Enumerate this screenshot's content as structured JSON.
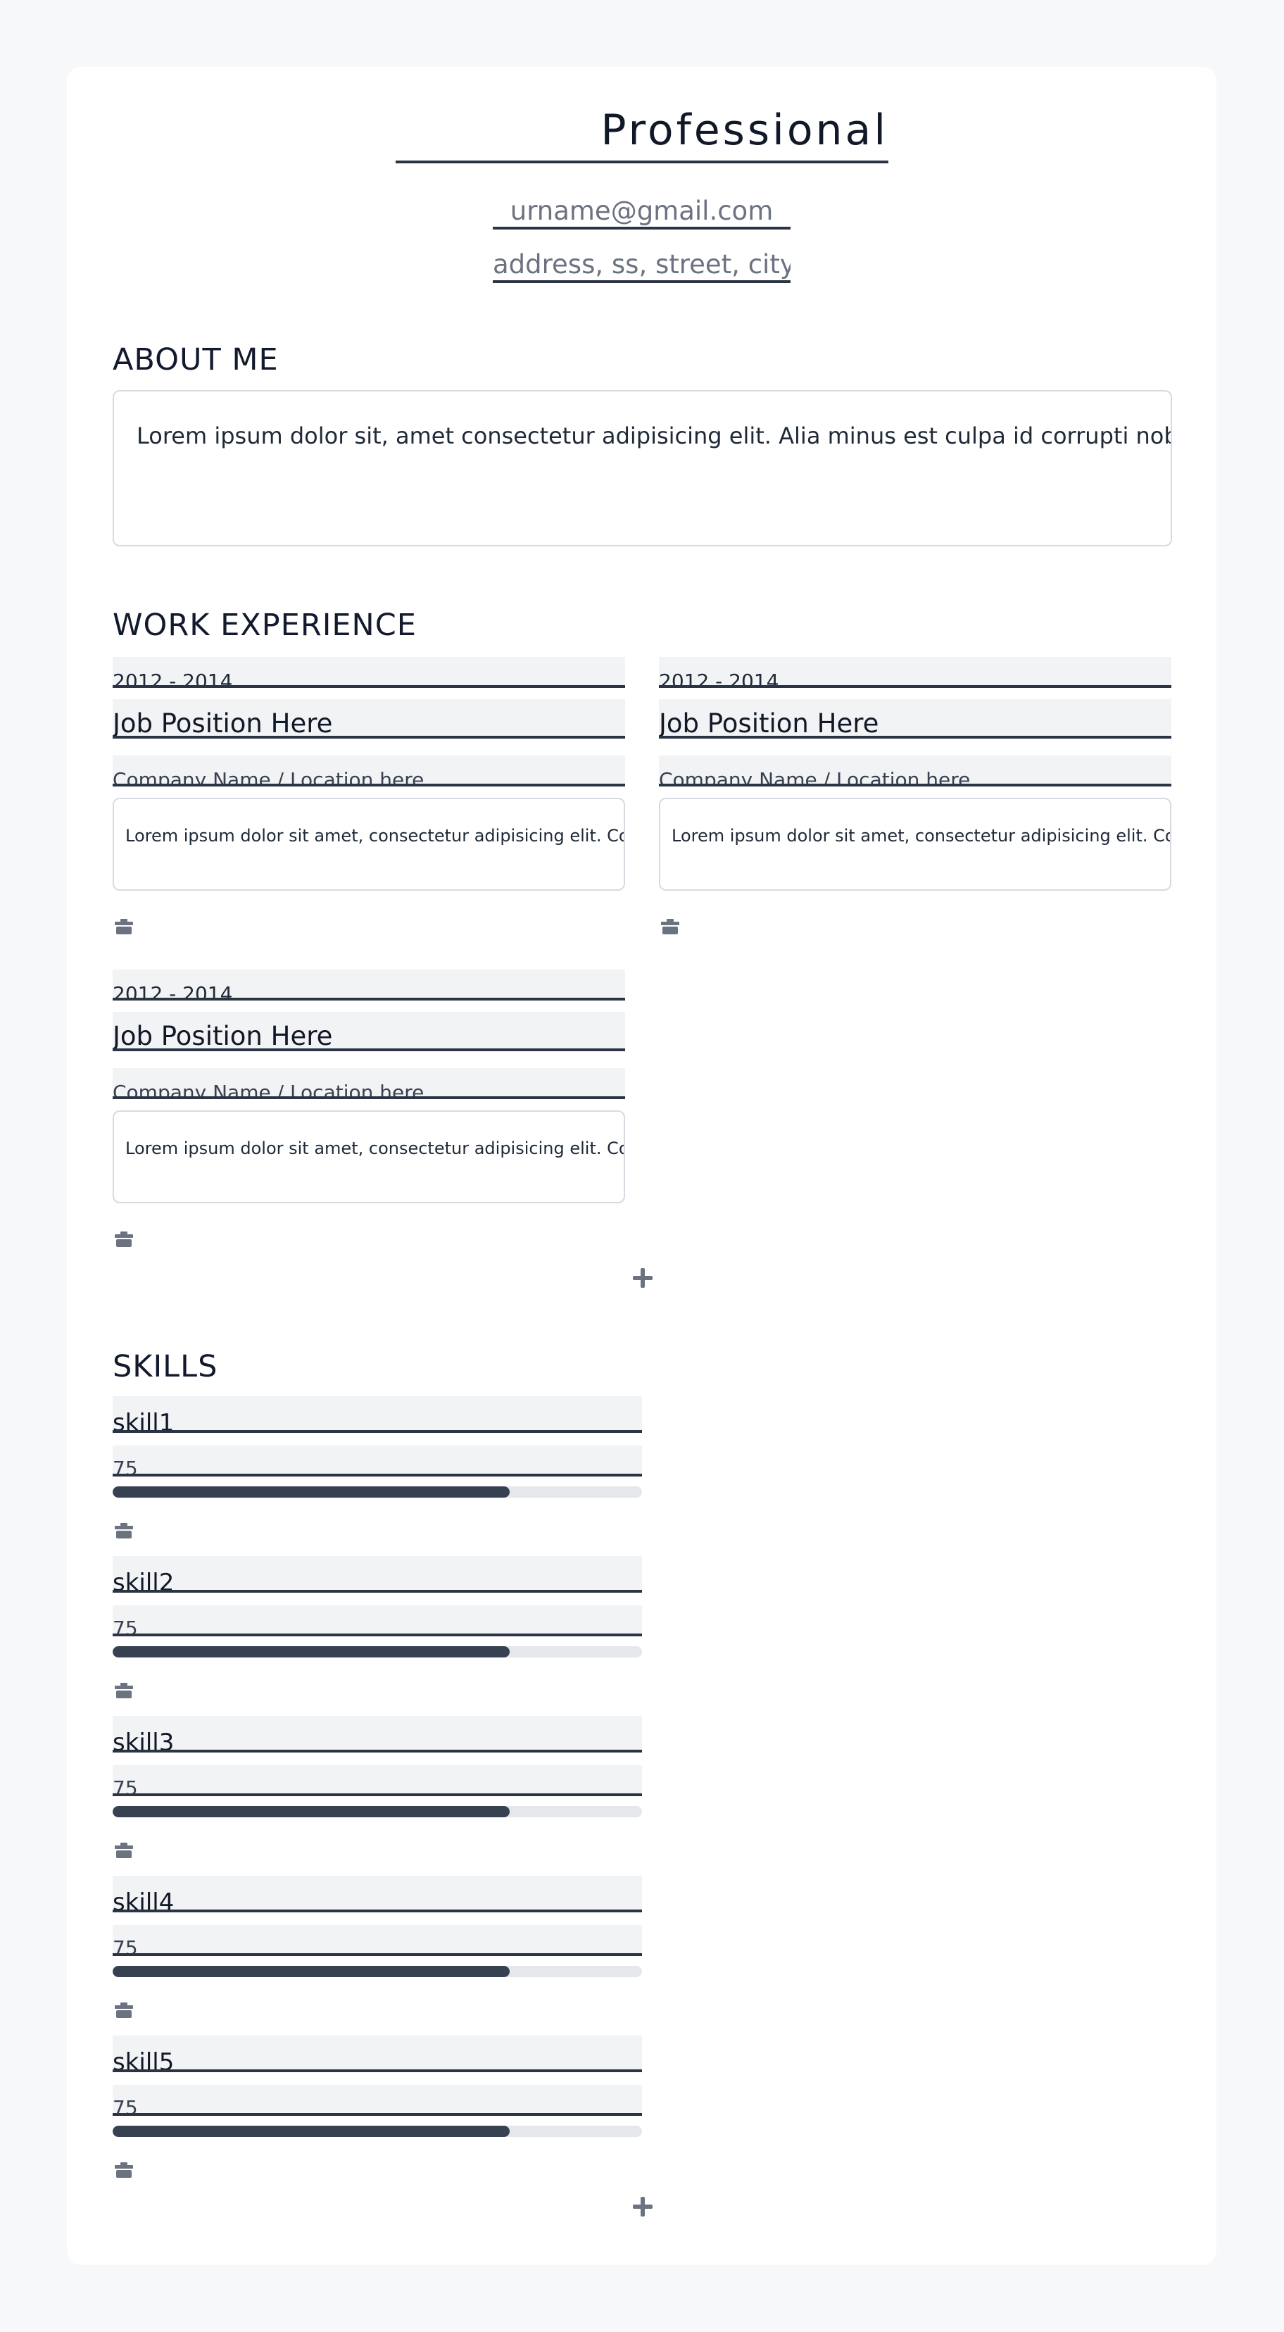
{
  "header": {
    "name": "Professional",
    "email": "urname@gmail.com",
    "address": "address, ss, street, city/zip"
  },
  "about": {
    "title": "ABOUT ME",
    "text": "Lorem ipsum dolor sit, amet consectetur adipisicing elit. Alia minus est culpa id corrupti nobis"
  },
  "work": {
    "title": "WORK EXPERIENCE",
    "jobs": [
      {
        "date": "2012 - 2014",
        "position": "Job Position Here",
        "company": "Company Name / Location here",
        "description": "Lorem ipsum dolor sit amet, consectetur adipisicing elit. Cor"
      },
      {
        "date": "2012 - 2014",
        "position": "Job Position Here",
        "company": "Company Name / Location here",
        "description": "Lorem ipsum dolor sit amet, consectetur adipisicing elit. Cor"
      },
      {
        "date": "2012 - 2014",
        "position": "Job Position Here",
        "company": "Company Name / Location here",
        "description": "Lorem ipsum dolor sit amet, consectetur adipisicing elit. Cor"
      }
    ],
    "add_icon": "plus-icon"
  },
  "skills": {
    "title": "SKILLS",
    "items": [
      {
        "name": "skill1",
        "level": "75",
        "value": 75
      },
      {
        "name": "skill2",
        "level": "75",
        "value": 75
      },
      {
        "name": "skill3",
        "level": "75",
        "value": 75
      },
      {
        "name": "skill4",
        "level": "75",
        "value": 75
      },
      {
        "name": "skill5",
        "level": "75",
        "value": 75
      }
    ],
    "add_icon": "plus-icon"
  },
  "icons": {
    "delete": "trash-icon",
    "add": "plus-icon"
  },
  "colors": {
    "bar_fill": "#374151",
    "bar_track": "#e5e7eb",
    "underline": "#2b3444"
  }
}
